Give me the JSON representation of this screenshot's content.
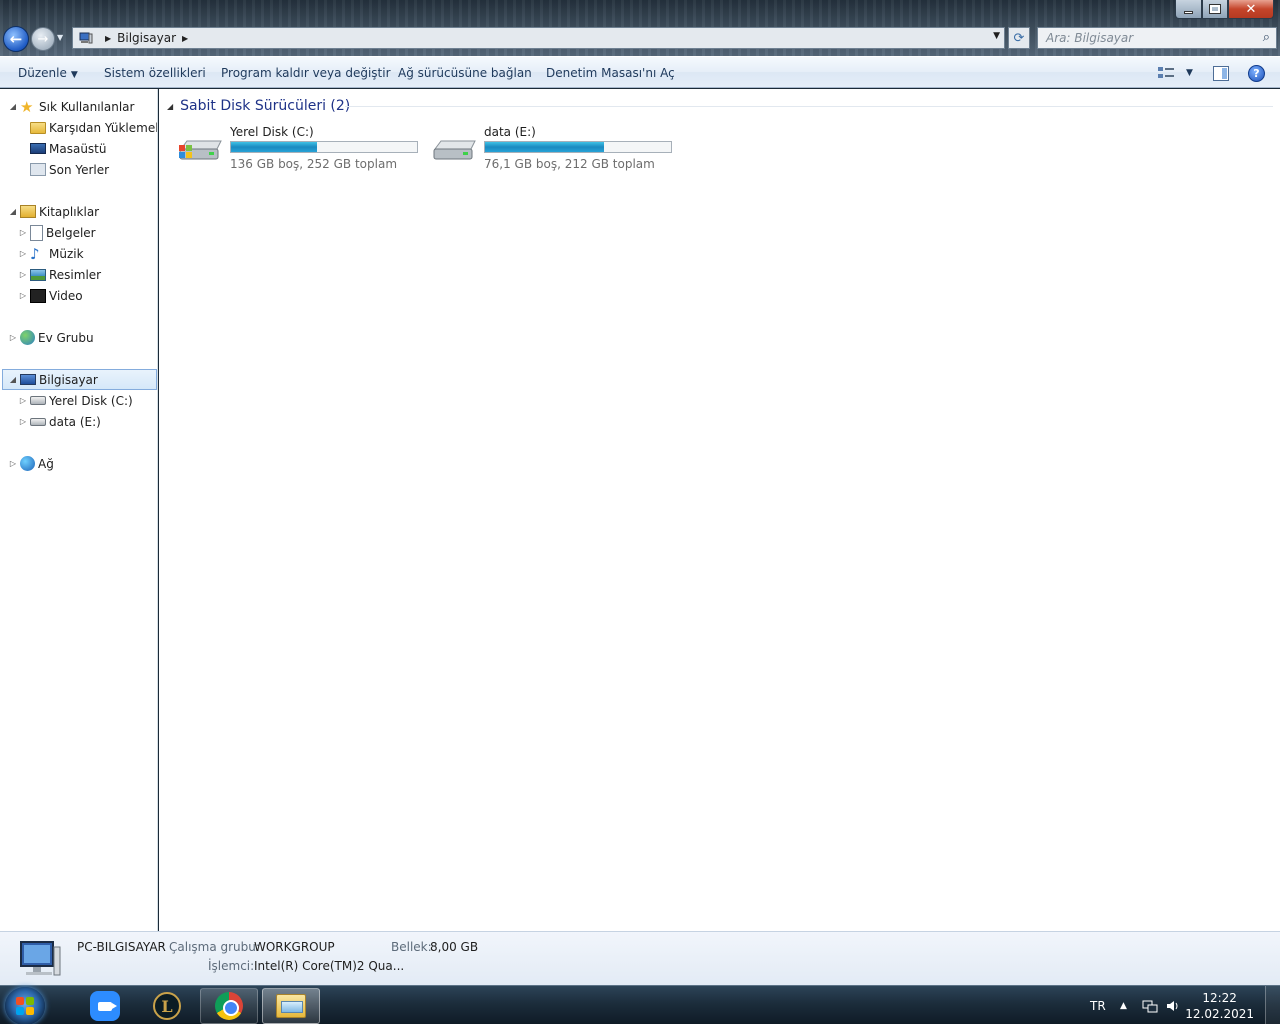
{
  "window": {
    "breadcrumb": "Bilgisayar",
    "search_placeholder": "Ara: Bilgisayar"
  },
  "toolbar": {
    "organize": "Düzenle",
    "system_properties": "Sistem özellikleri",
    "uninstall": "Program kaldır veya değiştir",
    "map_drive": "Ağ sürücüsüne bağlan",
    "control_panel": "Denetim Masası'nı Aç"
  },
  "nav": {
    "favorites": "Sık Kullanılanlar",
    "downloads": "Karşıdan Yüklemeler",
    "desktop": "Masaüstü",
    "recent": "Son Yerler",
    "libraries": "Kitaplıklar",
    "documents": "Belgeler",
    "music": "Müzik",
    "pictures": "Resimler",
    "video": "Video",
    "homegroup": "Ev Grubu",
    "computer": "Bilgisayar",
    "drive_c": "Yerel Disk (C:)",
    "drive_e": "data (E:)",
    "network": "Ağ"
  },
  "content": {
    "group_title": "Sabit Disk Sürücüleri (2)",
    "drives": [
      {
        "name": "Yerel Disk (C:)",
        "info": "136 GB boş, 252 GB toplam",
        "used_fraction": 0.46
      },
      {
        "name": "data (E:)",
        "info": "76,1 GB boş, 212 GB toplam",
        "used_fraction": 0.64
      }
    ]
  },
  "details": {
    "pc_name": "PC-BILGISAYAR",
    "workgroup_label": "Çalışma grubu:",
    "workgroup_value": "WORKGROUP",
    "memory_label": "Bellek:",
    "memory_value": "8,00 GB",
    "cpu_label": "İşlemci:",
    "cpu_value": "Intel(R) Core(TM)2 Qua..."
  },
  "taskbar": {
    "language": "TR",
    "time": "12:22",
    "date": "12.02.2021",
    "lol_letter": "L"
  },
  "colors": {
    "accent": "#1e3287",
    "bar_fill": "#27a2d6"
  }
}
